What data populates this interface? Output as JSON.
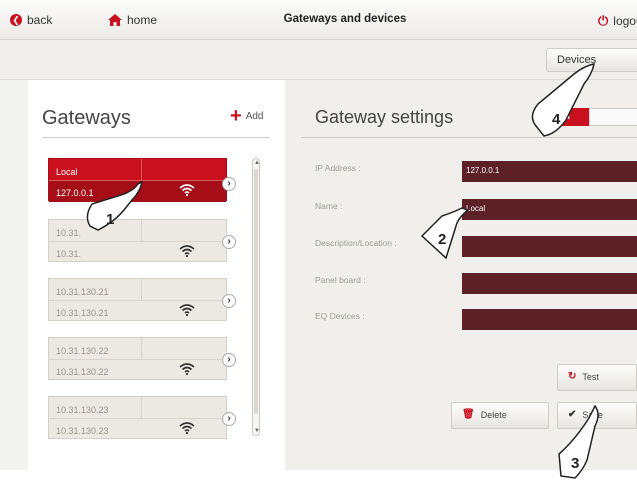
{
  "topbar": {
    "back_label": "back",
    "home_label": "home",
    "title": "Gateways and devices",
    "logout_label": "logou"
  },
  "subbar": {
    "devices_label": "Devices"
  },
  "gateways": {
    "title": "Gateways",
    "add_label": "Add",
    "items": [
      {
        "name": "Local",
        "ip": "127.0.0.1"
      },
      {
        "name": "10.31.",
        "ip": "10.31."
      },
      {
        "name": "10.31.130.21",
        "ip": "10.31.130.21"
      },
      {
        "name": "10.31.130.22",
        "ip": "10.31.130.22"
      },
      {
        "name": "10.31.130.23",
        "ip": "10.31.130.23"
      }
    ]
  },
  "settings": {
    "title": "Gateway settings",
    "toggle_on_label": "ON",
    "fields": [
      {
        "label": "IP Address :",
        "value": "127.0.0.1"
      },
      {
        "label": "Name :",
        "value": "Local"
      },
      {
        "label": "Description/Location :",
        "value": ""
      },
      {
        "label": "Panel board :",
        "value": ""
      },
      {
        "label": "EQ Devices :",
        "value": ""
      }
    ],
    "test_label": "Test",
    "delete_label": "Delete",
    "save_label": "Save"
  },
  "callouts": [
    "1",
    "2",
    "3",
    "4"
  ],
  "colors": {
    "accent": "#c8101e",
    "field_bg": "#5c2027",
    "panel_bg": "#f0efec"
  }
}
